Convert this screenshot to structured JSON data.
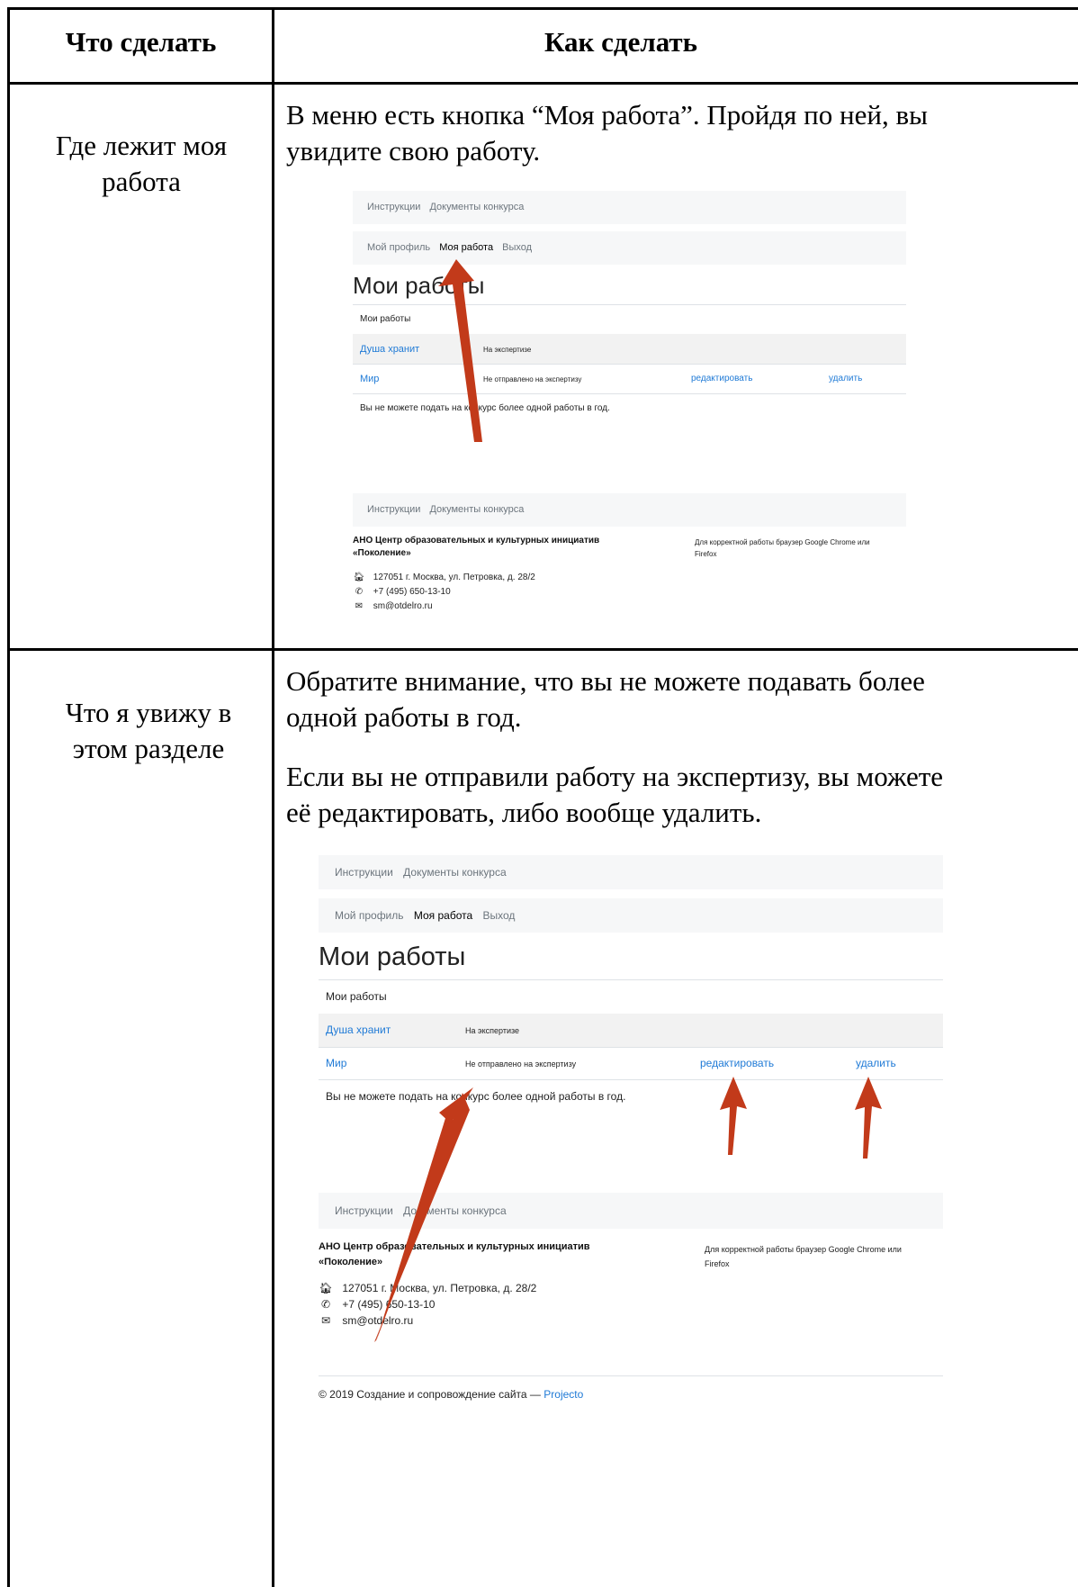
{
  "table": {
    "headers": {
      "what": "Что сделать",
      "how": "Как сделать"
    },
    "rows": [
      {
        "what": "Где лежит моя работа",
        "how_paragraphs": [
          "В меню есть кнопка “Моя работа”. Пройдя по ней, вы увидите свою работу."
        ]
      },
      {
        "what": "Что я увижу в этом разделе",
        "how_paragraphs": [
          "Обратите внимание, что вы не можете подавать более одной работы в год.",
          "Если вы не отправили работу на экспертизу, вы можете её редактировать, либо вообще удалить."
        ]
      }
    ]
  },
  "site": {
    "top_nav": [
      "Инструкции",
      "Документы конкурса"
    ],
    "user_nav": [
      "Мой профиль",
      "Моя работа",
      "Выход"
    ],
    "active_user_nav": "Моя работа",
    "page_heading": "Мои работы",
    "section_label": "Мои работы",
    "works": [
      {
        "title": "Душа хранит",
        "status": "На экспертизе",
        "edit": "",
        "delete": ""
      },
      {
        "title": "Мир",
        "status": "Не отправлено на экспертизу",
        "edit": "редактировать",
        "delete": "удалить"
      }
    ],
    "limit_notice": "Вы не можете подать на конкурс более одной работы в год.",
    "footer_nav": [
      "Инструкции",
      "Документы конкурса"
    ],
    "org_name": "АНО Центр образовательных и культурных инициатив «Поколение»",
    "browser_note": "Для корректной работы браузер Google Chrome или Firefox",
    "address": "127051 г. Москва, ул. Петровка, д. 28/2",
    "phone": "+7 (495) 650-13-10",
    "email": "sm@otdelro.ru",
    "copyright_prefix": "© 2019 Создание и сопровождение сайта — ",
    "copyright_link": "Projecto"
  },
  "colors": {
    "link": "#1f7ad6",
    "arrow": "#c23a1a",
    "bar_bg": "#f6f7f8"
  },
  "icons": {
    "address": "home-icon",
    "phone": "phone-icon",
    "email": "envelope-icon"
  }
}
